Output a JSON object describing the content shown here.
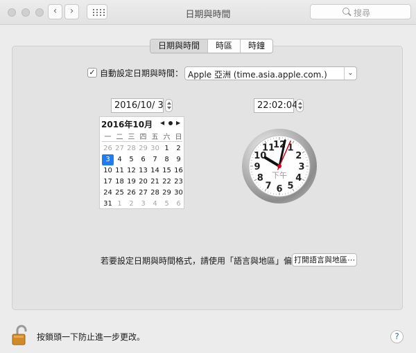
{
  "window": {
    "title": "日期與時間"
  },
  "toolbar": {
    "back_icon": "chevron-left-icon",
    "forward_icon": "chevron-right-icon",
    "grid_icon": "show-all-grid-icon",
    "search_placeholder": "搜尋"
  },
  "tabs": [
    {
      "label": "日期與時間",
      "active": true
    },
    {
      "label": "時區",
      "active": false
    },
    {
      "label": "時鐘",
      "active": false
    }
  ],
  "auto_set": {
    "checked": true,
    "check_mark": "✓",
    "label": "自動設定日期與時間：",
    "server": "Apple 亞洲 (time.asia.apple.com.)"
  },
  "date_field": "2016/10/  3",
  "time_field": "22:02:04",
  "calendar": {
    "title": "2016年10月",
    "prev": "◀",
    "next": "▶",
    "weekdays": [
      "一",
      "二",
      "三",
      "四",
      "五",
      "六",
      "日"
    ],
    "weeks": [
      [
        "26",
        "27",
        "28",
        "29",
        "30",
        "1",
        "2"
      ],
      [
        "3",
        "4",
        "5",
        "6",
        "7",
        "8",
        "9"
      ],
      [
        "10",
        "11",
        "12",
        "13",
        "14",
        "15",
        "16"
      ],
      [
        "17",
        "18",
        "19",
        "20",
        "21",
        "22",
        "23"
      ],
      [
        "24",
        "25",
        "26",
        "27",
        "28",
        "29",
        "30"
      ],
      [
        "31",
        "1",
        "2",
        "3",
        "4",
        "5",
        "6"
      ]
    ],
    "selected_day": "3"
  },
  "clock": {
    "period_label": "下午",
    "numbers": [
      "12",
      "1",
      "2",
      "3",
      "4",
      "5",
      "6",
      "7",
      "8",
      "9",
      "10",
      "11"
    ],
    "hours": 22,
    "minutes": 2,
    "seconds": 4,
    "second_hand_color": "#d0021b"
  },
  "format_hint": "若要設定日期與時間格式，請使用「語言與地區」偏好設定。",
  "open_region_button": "打開語言與地區⋯",
  "lock_label": "按鎖頭一下防止進一步更改。",
  "help_button": "?",
  "colors": {
    "accent": "#1d7cf2"
  }
}
